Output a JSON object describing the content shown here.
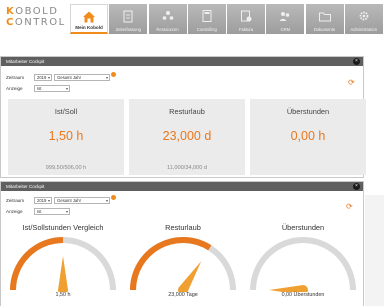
{
  "app": {
    "logo_line1_a": "K",
    "logo_line1_b": "OBOLD",
    "logo_line2_a": "C",
    "logo_line2_b": "ONTROL"
  },
  "nav": [
    {
      "label": "Mein Kobold",
      "icon": "house-icon",
      "active": true
    },
    {
      "label": "Zeiterfassung",
      "icon": "clipboard-icon"
    },
    {
      "label": "Ressourcen",
      "icon": "people-icon"
    },
    {
      "label": "Controlling",
      "icon": "calculator-icon"
    },
    {
      "label": "Faktura",
      "icon": "invoice-icon"
    },
    {
      "label": "CRM",
      "icon": "contacts-icon"
    },
    {
      "label": "Dokumente",
      "icon": "folder-icon"
    },
    {
      "label": "Administration",
      "icon": "gear-icon"
    }
  ],
  "panel1": {
    "title": "Mitarbeiter Cockpit",
    "close": "×",
    "zeitraum_label": "Zeitraum",
    "year": "2019",
    "period": "Gesamt Jahr",
    "anzeige_label": "Anzeige",
    "anzeige_value": "Ist",
    "cards": [
      {
        "title": "Ist/Soll",
        "value": "1,50 h",
        "sub": "999,50/506,00 h"
      },
      {
        "title": "Resturlaub",
        "value": "23,000 d",
        "sub": "11,000/34,000 d"
      },
      {
        "title": "Überstunden",
        "value": "0,00 h",
        "sub": ""
      }
    ]
  },
  "panel2": {
    "title": "Mitarbeiter Cockpit",
    "close": "×",
    "zeitraum_label": "Zeitraum",
    "year": "2019",
    "period": "Gesamt Jahr",
    "anzeige_label": "Anzeige",
    "anzeige_value": "Ist",
    "gauges": [
      {
        "title": "Ist/Sollstunden Vergleich",
        "value_text": "1,50 h",
        "level": 0.5
      },
      {
        "title": "Resturlaub",
        "value_text": "23,000 Tage",
        "level": 0.68
      },
      {
        "title": "Überstunden",
        "value_text": "0,00 Überstunden",
        "level": 0.0
      }
    ]
  },
  "colors": {
    "accent": "#e8781e",
    "gauge_track": "#d9d9d9",
    "header": "#5f5f5f"
  }
}
